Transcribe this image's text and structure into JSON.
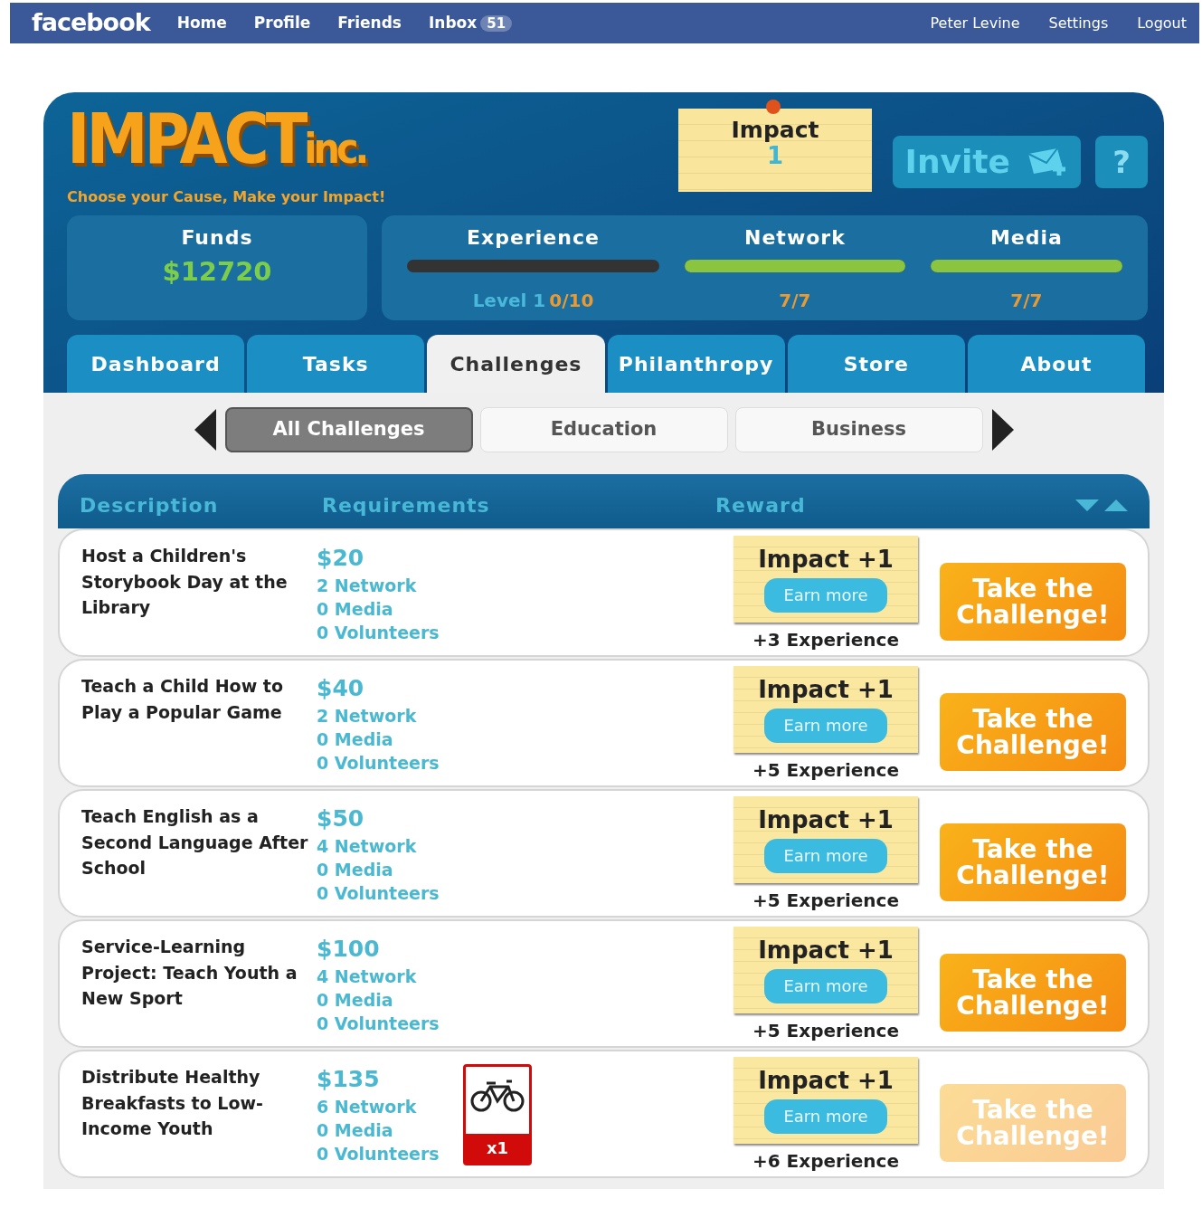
{
  "facebook_bar": {
    "logo": "facebook",
    "nav": [
      {
        "label": "Home"
      },
      {
        "label": "Profile"
      },
      {
        "label": "Friends"
      },
      {
        "label": "Inbox",
        "count": "51"
      }
    ],
    "account": [
      "Peter Levine",
      "Settings",
      "Logout"
    ]
  },
  "game": {
    "logo": {
      "main": "IMPACT",
      "suffix": "inc."
    },
    "tagline": "Choose your Cause, Make your Impact!",
    "impact_note": {
      "label": "Impact",
      "value": "1"
    },
    "invite_button": "Invite",
    "help_button": "?",
    "funds": {
      "label": "Funds",
      "value": "$12720"
    },
    "stats": [
      {
        "label": "Experience",
        "level": 0,
        "reading_prefix": "Level 1",
        "reading": "0/10"
      },
      {
        "label": "Network",
        "level": 1,
        "reading": "7/7"
      },
      {
        "label": "Media",
        "level": 1,
        "reading": "7/7"
      }
    ],
    "tabs": [
      {
        "label": "Dashboard",
        "selected": false
      },
      {
        "label": "Tasks",
        "selected": false
      },
      {
        "label": "Challenges",
        "selected": true
      },
      {
        "label": "Philanthropy",
        "selected": false
      },
      {
        "label": "Store",
        "selected": false
      },
      {
        "label": "About",
        "selected": false
      }
    ],
    "filters": [
      {
        "label": "All Challenges",
        "selected": true
      },
      {
        "label": "Education",
        "selected": false
      },
      {
        "label": "Business",
        "selected": false
      }
    ],
    "table": {
      "columns": [
        "Description",
        "Requirements",
        "Reward"
      ],
      "rows": [
        {
          "description": "Host a Children's Storybook Day at the Library",
          "funds": "$20",
          "requirements": [
            "2 Network",
            "0 Media",
            "0 Volunteers"
          ],
          "reward": "Impact +1",
          "earn_button": "Earn more",
          "experience": "+3 Experience",
          "action": "Take the Challenge!",
          "disabled": false
        },
        {
          "description": "Teach a Child How to Play a Popular Game",
          "funds": "$40",
          "requirements": [
            "2 Network",
            "0 Media",
            "0 Volunteers"
          ],
          "reward": "Impact +1",
          "earn_button": "Earn more",
          "experience": "+5 Experience",
          "action": "Take the Challenge!",
          "disabled": false
        },
        {
          "description": "Teach English as a Second Language After School",
          "funds": "$50",
          "requirements": [
            "4 Network",
            "0 Media",
            "0 Volunteers"
          ],
          "reward": "Impact +1",
          "earn_button": "Earn more",
          "experience": "+5 Experience",
          "action": "Take the Challenge!",
          "disabled": false
        },
        {
          "description": "Service-Learning Project: Teach Youth a New Sport",
          "funds": "$100",
          "requirements": [
            "4 Network",
            "0 Media",
            "0 Volunteers"
          ],
          "reward": "Impact +1",
          "earn_button": "Earn more",
          "experience": "+5 Experience",
          "action": "Take the Challenge!",
          "disabled": false
        },
        {
          "description": "Distribute Healthy Breakfasts to Low-Income Youth",
          "funds": "$135",
          "requirements": [
            "6 Network",
            "0 Media",
            "0 Volunteers"
          ],
          "item": {
            "count": "x1"
          },
          "reward": "Impact +1",
          "earn_button": "Earn more",
          "experience": "+6 Experience",
          "action": "Take the Challenge!",
          "disabled": true
        }
      ]
    }
  }
}
